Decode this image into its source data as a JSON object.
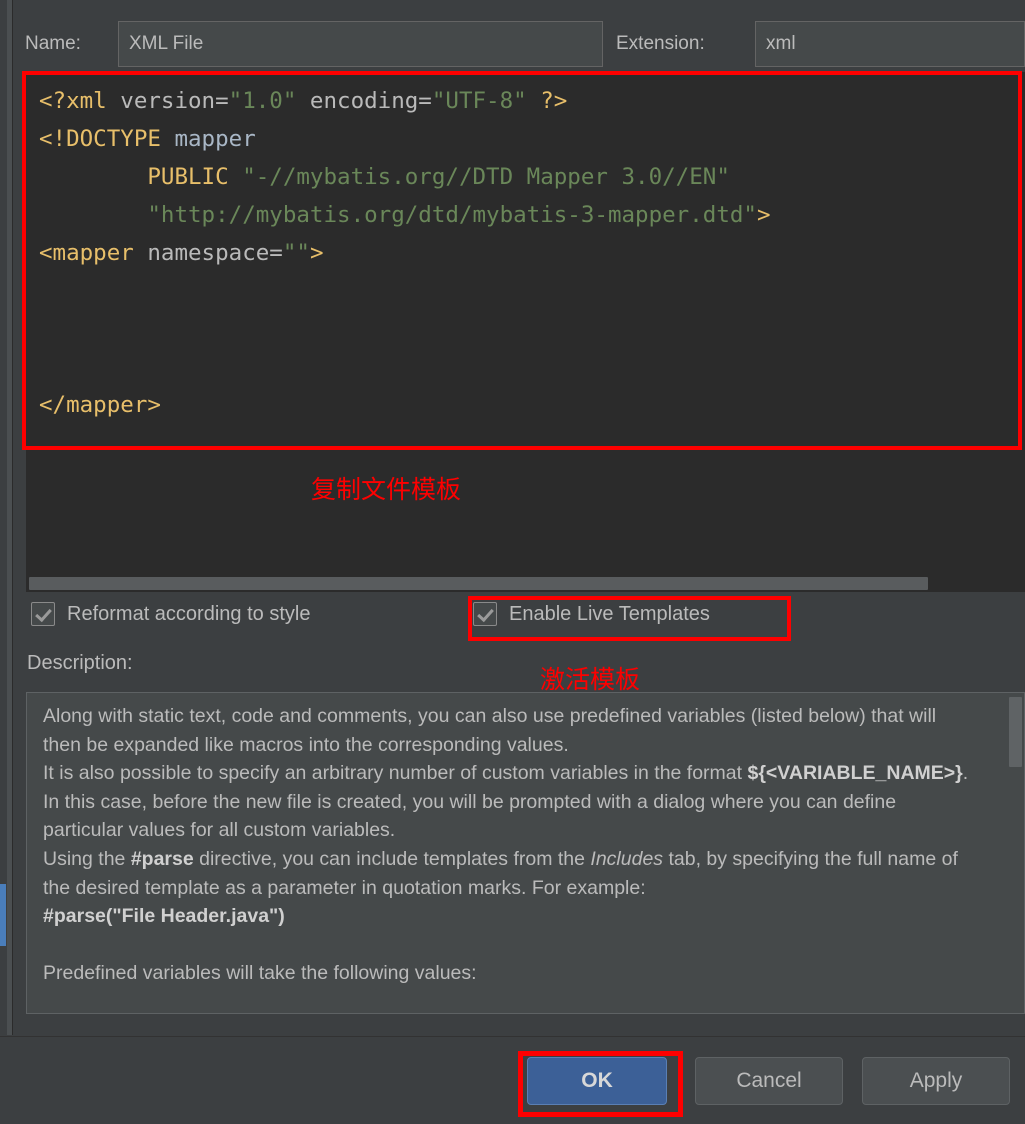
{
  "dialog": {
    "name_label": "Name:",
    "name_value": "XML File",
    "extension_label": "Extension:",
    "extension_value": "xml"
  },
  "editor": {
    "lines": [
      {
        "segments": [
          {
            "text": "<?xml",
            "cls": "tk-tag"
          },
          {
            "text": " version=",
            "cls": "tk-attr"
          },
          {
            "text": "\"1.0\"",
            "cls": "tk-val"
          },
          {
            "text": " encoding=",
            "cls": "tk-attr"
          },
          {
            "text": "\"UTF-8\"",
            "cls": "tk-val"
          },
          {
            "text": " ?>",
            "cls": "tk-tag"
          }
        ]
      },
      {
        "segments": [
          {
            "text": "<!DOCTYPE",
            "cls": "tk-tag"
          },
          {
            "text": " mapper",
            "cls": "tk-plain"
          }
        ]
      },
      {
        "segments": [
          {
            "text": "        PUBLIC ",
            "cls": "tk-tag"
          },
          {
            "text": "\"-//mybatis.org//DTD Mapper 3.0//EN\"",
            "cls": "tk-val"
          }
        ]
      },
      {
        "segments": [
          {
            "text": "        ",
            "cls": "tk-plain"
          },
          {
            "text": "\"http://mybatis.org/dtd/mybatis-3-mapper.dtd\"",
            "cls": "tk-val"
          },
          {
            "text": ">",
            "cls": "tk-tag"
          }
        ]
      },
      {
        "segments": [
          {
            "text": "<mapper",
            "cls": "tk-tag"
          },
          {
            "text": " namespace=",
            "cls": "tk-attr"
          },
          {
            "text": "\"\"",
            "cls": "tk-val"
          },
          {
            "text": ">",
            "cls": "tk-tag"
          }
        ]
      },
      {
        "segments": [
          {
            "text": "",
            "cls": "tk-plain"
          }
        ]
      },
      {
        "segments": [
          {
            "text": "",
            "cls": "tk-plain"
          }
        ]
      },
      {
        "segments": [
          {
            "text": "",
            "cls": "tk-plain"
          }
        ]
      },
      {
        "segments": [
          {
            "text": "</mapper>",
            "cls": "tk-tag"
          }
        ]
      }
    ]
  },
  "annotations": {
    "copy_file_template": "复制文件模板",
    "activate_template": "激活模板",
    "highlight_color": "#fe0000"
  },
  "options": {
    "reformat_label": "Reformat according to style",
    "reformat_checked": true,
    "live_templates_label": "Enable Live Templates",
    "live_templates_checked": true
  },
  "description": {
    "label": "Description:"
  },
  "footer": {
    "ok_label": "OK",
    "cancel_label": "Cancel",
    "apply_label": "Apply",
    "ok_accent_color": "#3c6097"
  }
}
